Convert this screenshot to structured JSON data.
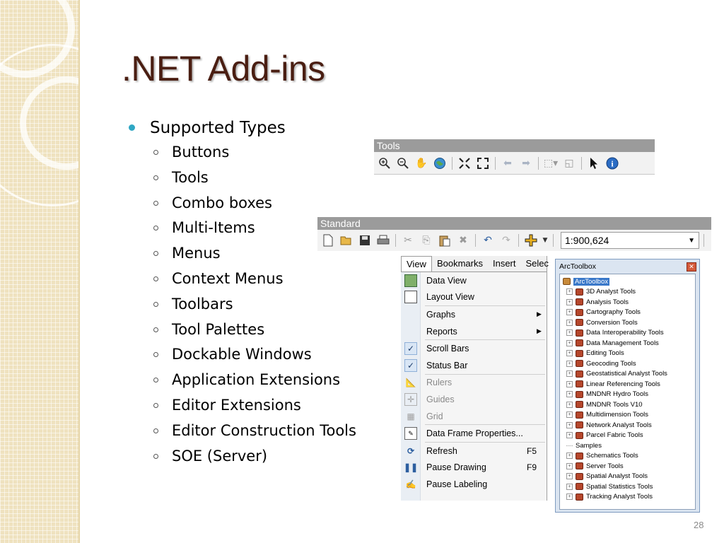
{
  "slide": {
    "title": ".NET Add-ins",
    "bullet": "Supported Types",
    "sub_items": [
      "Buttons",
      "Tools",
      "Combo boxes",
      "Multi-Items",
      "Menus",
      "Context Menus",
      "Toolbars",
      "Tool Palettes",
      "Dockable Windows",
      "Application Extensions",
      "Editor Extensions",
      "Editor Construction Tools",
      "SOE (Server)"
    ],
    "page_number": "28",
    "bullet_color": "#2fa7c4",
    "title_color": "#4a1e12"
  },
  "tools_toolbar": {
    "title": "Tools",
    "icons": [
      "zoom-in-icon",
      "zoom-out-icon",
      "pan-icon",
      "full-extent-icon",
      "fixed-zoom-in-icon",
      "fixed-zoom-out-icon",
      "back-icon",
      "forward-icon",
      "select-features-icon",
      "clear-selection-icon",
      "select-elements-icon",
      "identify-icon"
    ]
  },
  "standard_toolbar": {
    "title": "Standard",
    "scale_value": "1:900,624",
    "icons": [
      "new-icon",
      "open-icon",
      "save-icon",
      "print-icon",
      "cut-icon",
      "copy-icon",
      "paste-icon",
      "delete-icon",
      "undo-icon",
      "redo-icon",
      "add-data-icon"
    ]
  },
  "view_menu": {
    "menubar": [
      "View",
      "Bookmarks",
      "Insert",
      "Selec"
    ],
    "items": [
      {
        "label": "Data View",
        "icon": "data-view-icon"
      },
      {
        "label": "Layout View",
        "icon": "layout-view-icon"
      },
      {
        "label": "Graphs",
        "submenu": true
      },
      {
        "label": "Reports",
        "submenu": true
      },
      {
        "label": "Scroll Bars",
        "checked": true
      },
      {
        "label": "Status Bar",
        "checked": true
      },
      {
        "label": "Rulers",
        "disabled": true
      },
      {
        "label": "Guides",
        "disabled": true
      },
      {
        "label": "Grid",
        "disabled": true
      },
      {
        "label": "Data Frame Properties..."
      },
      {
        "label": "Refresh",
        "shortcut": "F5"
      },
      {
        "label": "Pause Drawing",
        "shortcut": "F9"
      },
      {
        "label": "Pause Labeling"
      }
    ]
  },
  "arctoolbox": {
    "title": "ArcToolbox",
    "root": "ArcToolbox",
    "toolboxes": [
      "3D Analyst Tools",
      "Analysis Tools",
      "Cartography Tools",
      "Conversion Tools",
      "Data Interoperability Tools",
      "Data Management Tools",
      "Editing Tools",
      "Geocoding Tools",
      "Geostatistical Analyst Tools",
      "Linear Referencing Tools",
      "MNDNR Hydro Tools",
      "MNDNR Tools V10",
      "Multidimension Tools",
      "Network Analyst Tools",
      "Parcel Fabric Tools",
      "Samples",
      "Schematics Tools",
      "Server Tools",
      "Spatial Analyst Tools",
      "Spatial Statistics Tools",
      "Tracking Analyst Tools"
    ]
  }
}
